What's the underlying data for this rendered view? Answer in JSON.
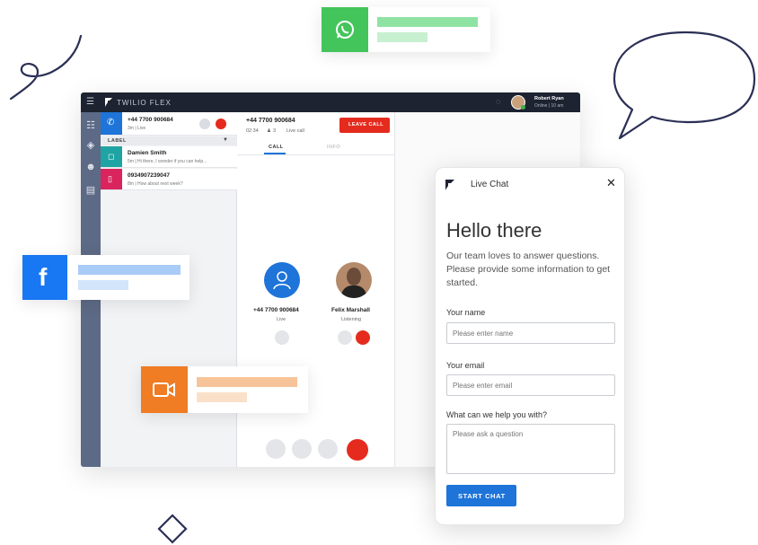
{
  "flex": {
    "app_title": "TWILIO FLEX",
    "user_name": "Robert Ryan",
    "user_status": "Online | 10 am",
    "active_task": {
      "number": "+44 7700 900684",
      "sub": "3m | Live"
    },
    "filter_label": "LABEL",
    "tasks": [
      {
        "title": "Damien Smith",
        "sub": "5m | Hi there, I wonder if you can help..."
      },
      {
        "title": "0934907239047",
        "sub": "8m | How about next week?"
      }
    ],
    "call_header": {
      "number": "+44 7700 900684",
      "duration": "02:34",
      "participants": "3",
      "status": "Live call",
      "leave_label": "LEAVE CALL"
    },
    "tabs": [
      "CALL",
      "INFO"
    ],
    "participants": [
      {
        "name": "+44 7700 900684",
        "status": "Live"
      },
      {
        "name": "Felix Marshall",
        "status": "Listening"
      }
    ]
  },
  "live_chat": {
    "title": "Live Chat",
    "greeting": "Hello there",
    "intro": "Our team loves to answer questions. Please provide some information to get started.",
    "name_label": "Your name",
    "name_placeholder": "Please enter name",
    "email_label": "Your email",
    "email_placeholder": "Please enter email",
    "question_label": "What can we help you with?",
    "question_placeholder": "Please ask a question",
    "submit_label": "START CHAT"
  },
  "colors": {
    "whatsapp": "#43c55c",
    "facebook": "#1877f2",
    "video": "#f07c24",
    "accent_blue": "#1e74d9",
    "danger_red": "#e52b1e",
    "nav_dark": "#1d2330"
  },
  "icons": [
    "whatsapp-icon",
    "facebook-icon",
    "video-camera-icon",
    "speech-bubble-icon",
    "flex-logo-icon",
    "close-icon",
    "phone-icon",
    "mute-icon",
    "transfer-icon",
    "dialpad-icon",
    "hangup-icon"
  ]
}
